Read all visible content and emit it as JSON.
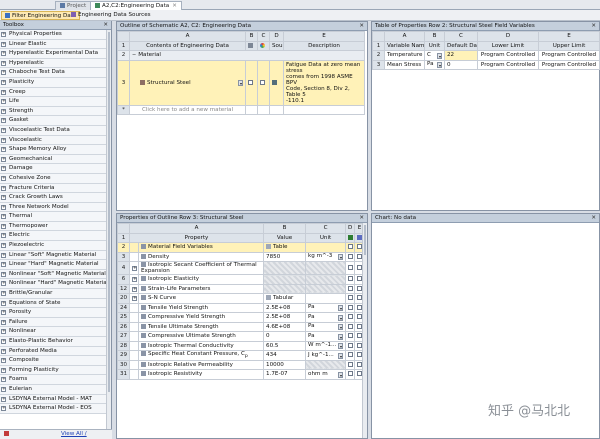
{
  "tabs": [
    {
      "label": "Project"
    },
    {
      "label": "A2,C2:Engineering Data"
    }
  ],
  "toolbar": {
    "filter": "Filter Engineering Data",
    "sources": "Engineering Data Sources"
  },
  "toolbox": {
    "title": "Toolbox",
    "items": [
      "Physical Properties",
      "Linear Elastic",
      "Hyperelastic Experimental Data",
      "Hyperelastic",
      "Chaboche Test Data",
      "Plasticity",
      "Creep",
      "Life",
      "Strength",
      "Gasket",
      "Viscoelastic Test Data",
      "Viscoelastic",
      "Shape Memory Alloy",
      "Geomechanical",
      "Damage",
      "Cohesive Zone",
      "Fracture Criteria",
      "Crack Growth Laws",
      "Three Network Model",
      "Thermal",
      "Thermopower",
      "Electric",
      "Piezoelectric",
      "Linear \"Soft\" Magnetic Material",
      "Linear \"Hard\" Magnetic Material",
      "Nonlinear \"Soft\" Magnetic Material",
      "Nonlinear \"Hard\" Magnetic Material",
      "Brittle/Granular",
      "Equations of State",
      "Porosity",
      "Failure",
      "Nonlinear",
      "Elasto-Plastic Behavior",
      "Perforated Media",
      "Composite",
      "Forming Plasticity",
      "Foams",
      "Eulerian",
      "LSDYNA External Model - MAT",
      "LSDYNA External Model - EOS"
    ],
    "view_all": "View All / Customize..."
  },
  "outline": {
    "title": "Outline of Schematic A2, C2: Engineering Data",
    "columns": [
      "A",
      "B",
      "C",
      "D",
      "E"
    ],
    "headers": {
      "name": "Contents of Engineering Data",
      "source": "Source",
      "description": "Description"
    },
    "rows": [
      {
        "num": "1"
      },
      {
        "num": "2",
        "label": "Material"
      },
      {
        "num": "3",
        "name": "Structural Steel",
        "desc1": "Fatigue Data at zero mean stress",
        "desc2": "comes from 1998 ASME BPV",
        "desc3": "Code, Section 8, Div 2, Table 5",
        "desc4": "-110.1"
      },
      {
        "num": "*",
        "name": "Click here to add a new material"
      }
    ]
  },
  "table": {
    "title": "Table of Properties Row 2: Structural Steel Field Variables",
    "columns": [
      "A",
      "B",
      "C",
      "D",
      "E"
    ],
    "headers": [
      "Variable Name",
      "Unit",
      "Default Data",
      "Lower Limit",
      "Upper Limit"
    ],
    "rows": [
      {
        "num": "1"
      },
      {
        "num": "2",
        "name": "Temperature",
        "unit": "C",
        "default": "22",
        "lower": "Program Controlled",
        "upper": "Program Controlled"
      },
      {
        "num": "3",
        "name": "Mean Stress",
        "unit": "Pa",
        "default": "0",
        "lower": "Program Controlled",
        "upper": "Program Controlled"
      }
    ]
  },
  "properties": {
    "title": "Properties of Outline Row 3: Structural Steel",
    "columns": [
      "A",
      "B",
      "C",
      "D",
      "E"
    ],
    "headers": {
      "property": "Property",
      "value": "Value",
      "unit": "Unit"
    },
    "rows": [
      {
        "num": "1"
      },
      {
        "num": "2",
        "name": "Material Field Variables",
        "value": "Table",
        "unit": ""
      },
      {
        "num": "3",
        "name": "Density",
        "value": "7850",
        "unit": "kg m^-3"
      },
      {
        "num": "4",
        "name": "Isotropic Secant Coefficient of Thermal Expansion",
        "value": "",
        "unit": ""
      },
      {
        "num": "6",
        "name": "Isotropic Elasticity",
        "value": "",
        "unit": ""
      },
      {
        "num": "12",
        "name": "Strain-Life Parameters",
        "value": "",
        "unit": ""
      },
      {
        "num": "20",
        "name": "S-N Curve",
        "value": "Tabular",
        "unit": ""
      },
      {
        "num": "24",
        "name": "Tensile Yield Strength",
        "value": "2.5E+08",
        "unit": "Pa"
      },
      {
        "num": "25",
        "name": "Compressive Yield Strength",
        "value": "2.5E+08",
        "unit": "Pa"
      },
      {
        "num": "26",
        "name": "Tensile Ultimate Strength",
        "value": "4.6E+08",
        "unit": "Pa"
      },
      {
        "num": "27",
        "name": "Compressive Ultimate Strength",
        "value": "0",
        "unit": "Pa"
      },
      {
        "num": "28",
        "name": "Isotropic Thermal Conductivity",
        "value": "60.5",
        "unit": "W m^-1..."
      },
      {
        "num": "29",
        "name": "Specific Heat Constant Pressure, C",
        "sub": "p",
        "value": "434",
        "unit": "J kg^-1..."
      },
      {
        "num": "30",
        "name": "Isotropic Relative Permeability",
        "value": "10000",
        "unit": ""
      },
      {
        "num": "31",
        "name": "Isotropic Resistivity",
        "value": "1.7E-07",
        "unit": "ohm m"
      }
    ]
  },
  "chart": {
    "title": "Chart: No data"
  },
  "watermark": "知乎 @马北北",
  "colors": {
    "panel_title": "#c4cfdc",
    "selected_row": "#fff2b8",
    "link": "#1c3fb5"
  }
}
